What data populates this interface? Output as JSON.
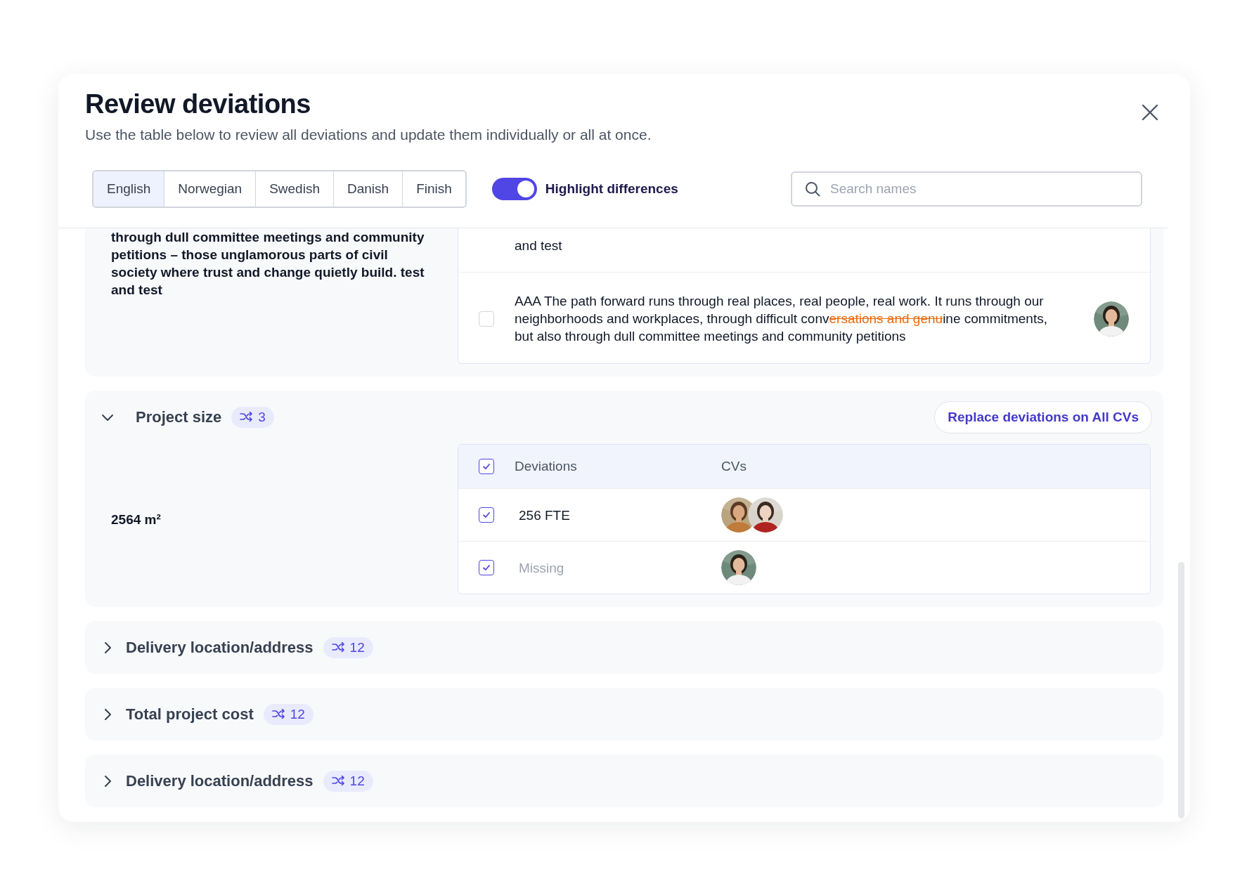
{
  "dialog": {
    "title": "Review deviations",
    "subtitle": "Use the table below to review all deviations and update them individually or all at once."
  },
  "language_tabs": [
    {
      "label": "English",
      "selected": true
    },
    {
      "label": "Norwegian",
      "selected": false
    },
    {
      "label": "Swedish",
      "selected": false
    },
    {
      "label": "Danish",
      "selected": false
    },
    {
      "label": "Finish",
      "selected": false
    }
  ],
  "highlight_toggle": {
    "label": "Highlight differences",
    "on": true
  },
  "search": {
    "placeholder": "Search names"
  },
  "sections": [
    {
      "expanded": true,
      "source_value": "through dull committee meetings and community petitions – those unglamorous parts of civil society where trust and change quietly build. test and test",
      "rows": [
        {
          "segments": [
            {
              "text": "and test",
              "diff": false
            }
          ],
          "avatars": []
        },
        {
          "checked": false,
          "segments": [
            {
              "text": "AAA The path forward runs through real places, real people, real work. It runs through our neighborhoods and workplaces, through difficult conv",
              "diff": false
            },
            {
              "text": "ersations and genu",
              "diff": true
            },
            {
              "text": "ine commitments, but also through dull committee meetings and community petitions",
              "diff": false
            }
          ],
          "avatars": [
            {
              "kind": "picture"
            }
          ]
        }
      ]
    },
    {
      "expanded": true,
      "title": "Project size",
      "count": "3",
      "action": "Replace deviations on All CVs",
      "source_value": "2564 m²",
      "columns": [
        "Deviations",
        "CVs"
      ],
      "all_checked": true,
      "rows": [
        {
          "checked": true,
          "missing": false,
          "segments": [
            {
              "text": "256 FTE",
              "diff": false
            }
          ],
          "avatars": [
            {
              "kind": "picture"
            },
            {
              "kind": "picture"
            }
          ]
        },
        {
          "checked": true,
          "missing": true,
          "segments": [
            {
              "text": "Missing",
              "diff": false
            }
          ],
          "avatars": [
            {
              "kind": "picture"
            }
          ]
        }
      ]
    },
    {
      "expanded": false,
      "title": "Delivery location/address",
      "count": "12"
    },
    {
      "expanded": false,
      "title": "Total project cost",
      "count": "12"
    },
    {
      "expanded": false,
      "title": "Delivery location/address",
      "count": "12"
    }
  ]
}
